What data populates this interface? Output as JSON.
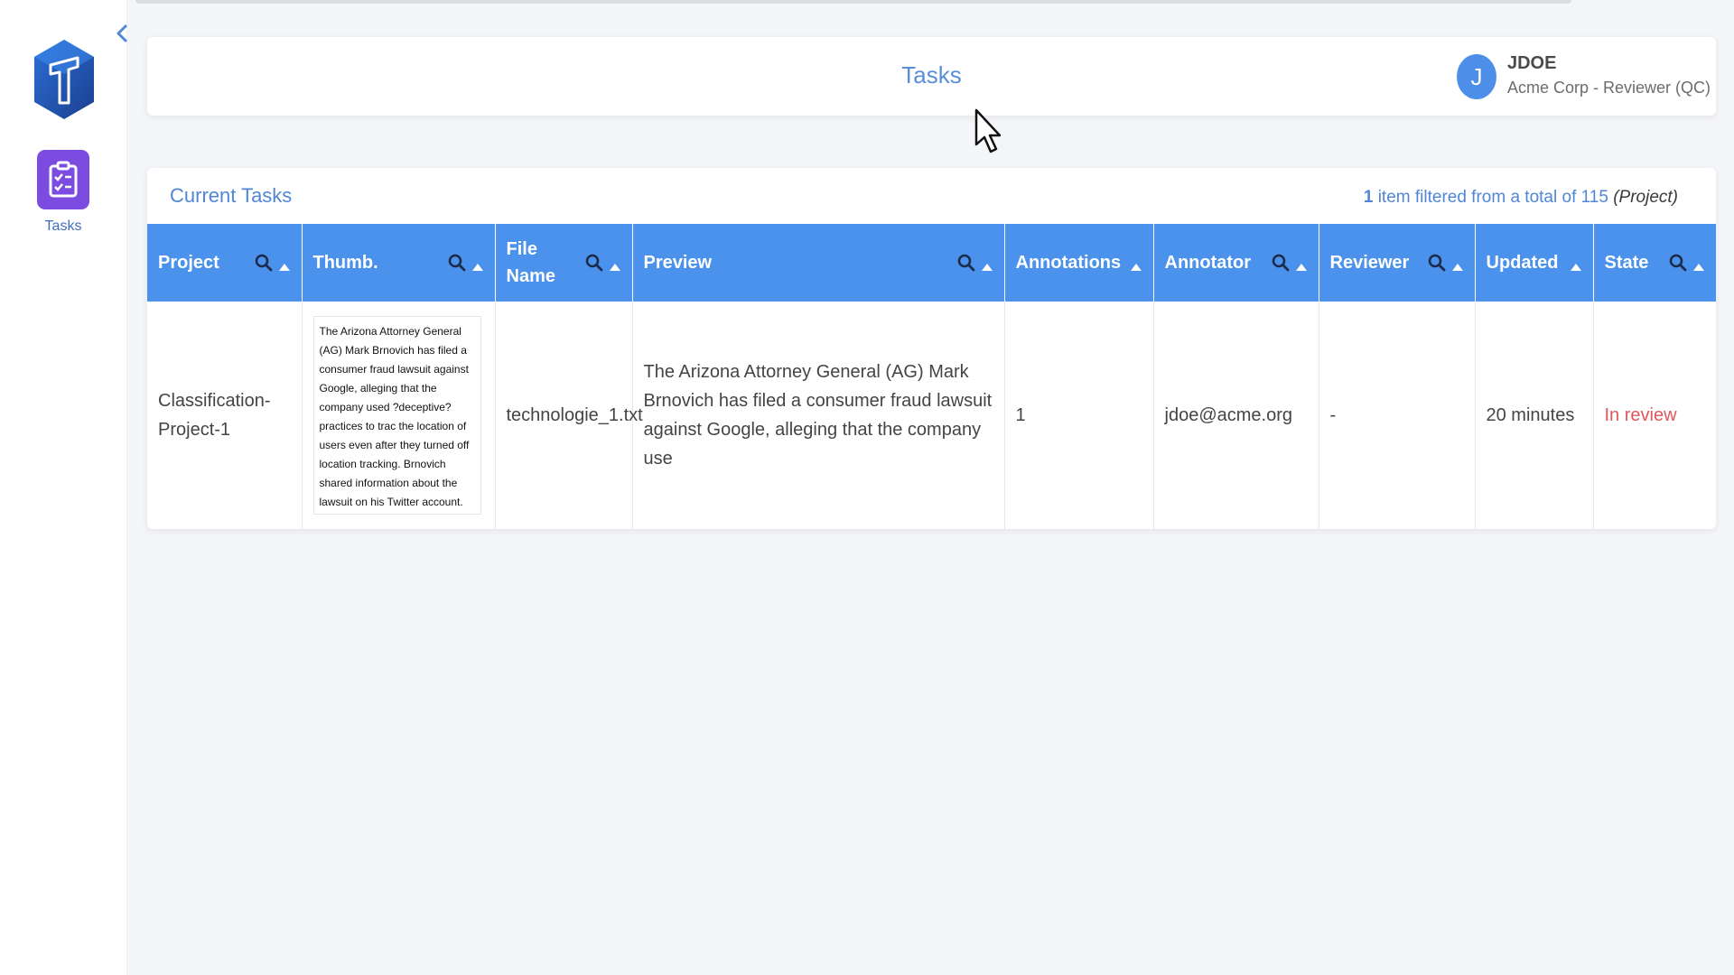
{
  "sidebar": {
    "nav": [
      {
        "label": "Tasks",
        "icon": "clipboard-check-icon"
      }
    ],
    "collapse_icon": "chevron-left-icon",
    "logo_icon": "hexagon-logo-icon"
  },
  "header": {
    "title": "Tasks",
    "user": {
      "initial": "J",
      "name": "JDOE",
      "role": "Acme Corp - Reviewer (QC)"
    }
  },
  "current_tasks": {
    "title": "Current Tasks",
    "filter": {
      "count": "1",
      "text": " item filtered from a total of 115 ",
      "scope": "(Project)"
    },
    "columns": [
      {
        "label": "Project",
        "search": true,
        "sort": true
      },
      {
        "label": "Thumb.",
        "search": true,
        "sort": true
      },
      {
        "label": "File Name",
        "search": true,
        "sort": true
      },
      {
        "label": "Preview",
        "search": true,
        "sort": true
      },
      {
        "label": "Annotations",
        "search": false,
        "sort": true
      },
      {
        "label": "Annotator",
        "search": true,
        "sort": true
      },
      {
        "label": "Reviewer",
        "search": true,
        "sort": true
      },
      {
        "label": "Updated",
        "search": false,
        "sort": true
      },
      {
        "label": "State",
        "search": true,
        "sort": true
      }
    ],
    "rows": [
      {
        "project": "Classification-Project-1",
        "thumb": "The Arizona Attorney General (AG) Mark Brnovich has filed a consumer fraud lawsuit against Google, alleging that the company used ?deceptive? practices to trac the location of users even after they turned off location tracking.    Brnovich shared information about the lawsuit on his Twitter account. He accused",
        "file_name": "technologie_1.txt",
        "preview": "The Arizona Attorney General (AG) Mark Brnovich has filed a consumer fraud lawsuit against Google, alleging that the company use",
        "annotations": "1",
        "annotator": "jdoe@acme.org",
        "reviewer": "-",
        "updated": "20 minutes",
        "state": "In review"
      }
    ]
  },
  "colors": {
    "accent": "#4b92ec",
    "title_blue": "#5a8fd8",
    "nav_purple": "#7c4ce0",
    "state_red": "#e0575b",
    "avatar_blue": "#4d8fe8"
  }
}
